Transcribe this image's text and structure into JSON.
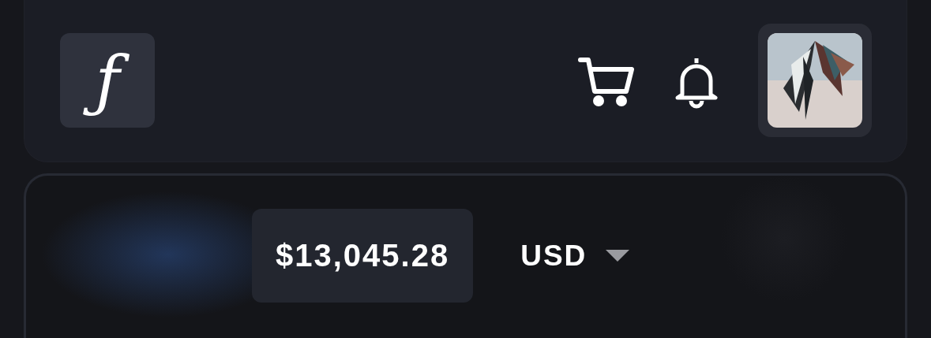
{
  "header": {
    "logo": "ƒ"
  },
  "balance": {
    "amount": "$13,045.28",
    "currency": "USD"
  }
}
